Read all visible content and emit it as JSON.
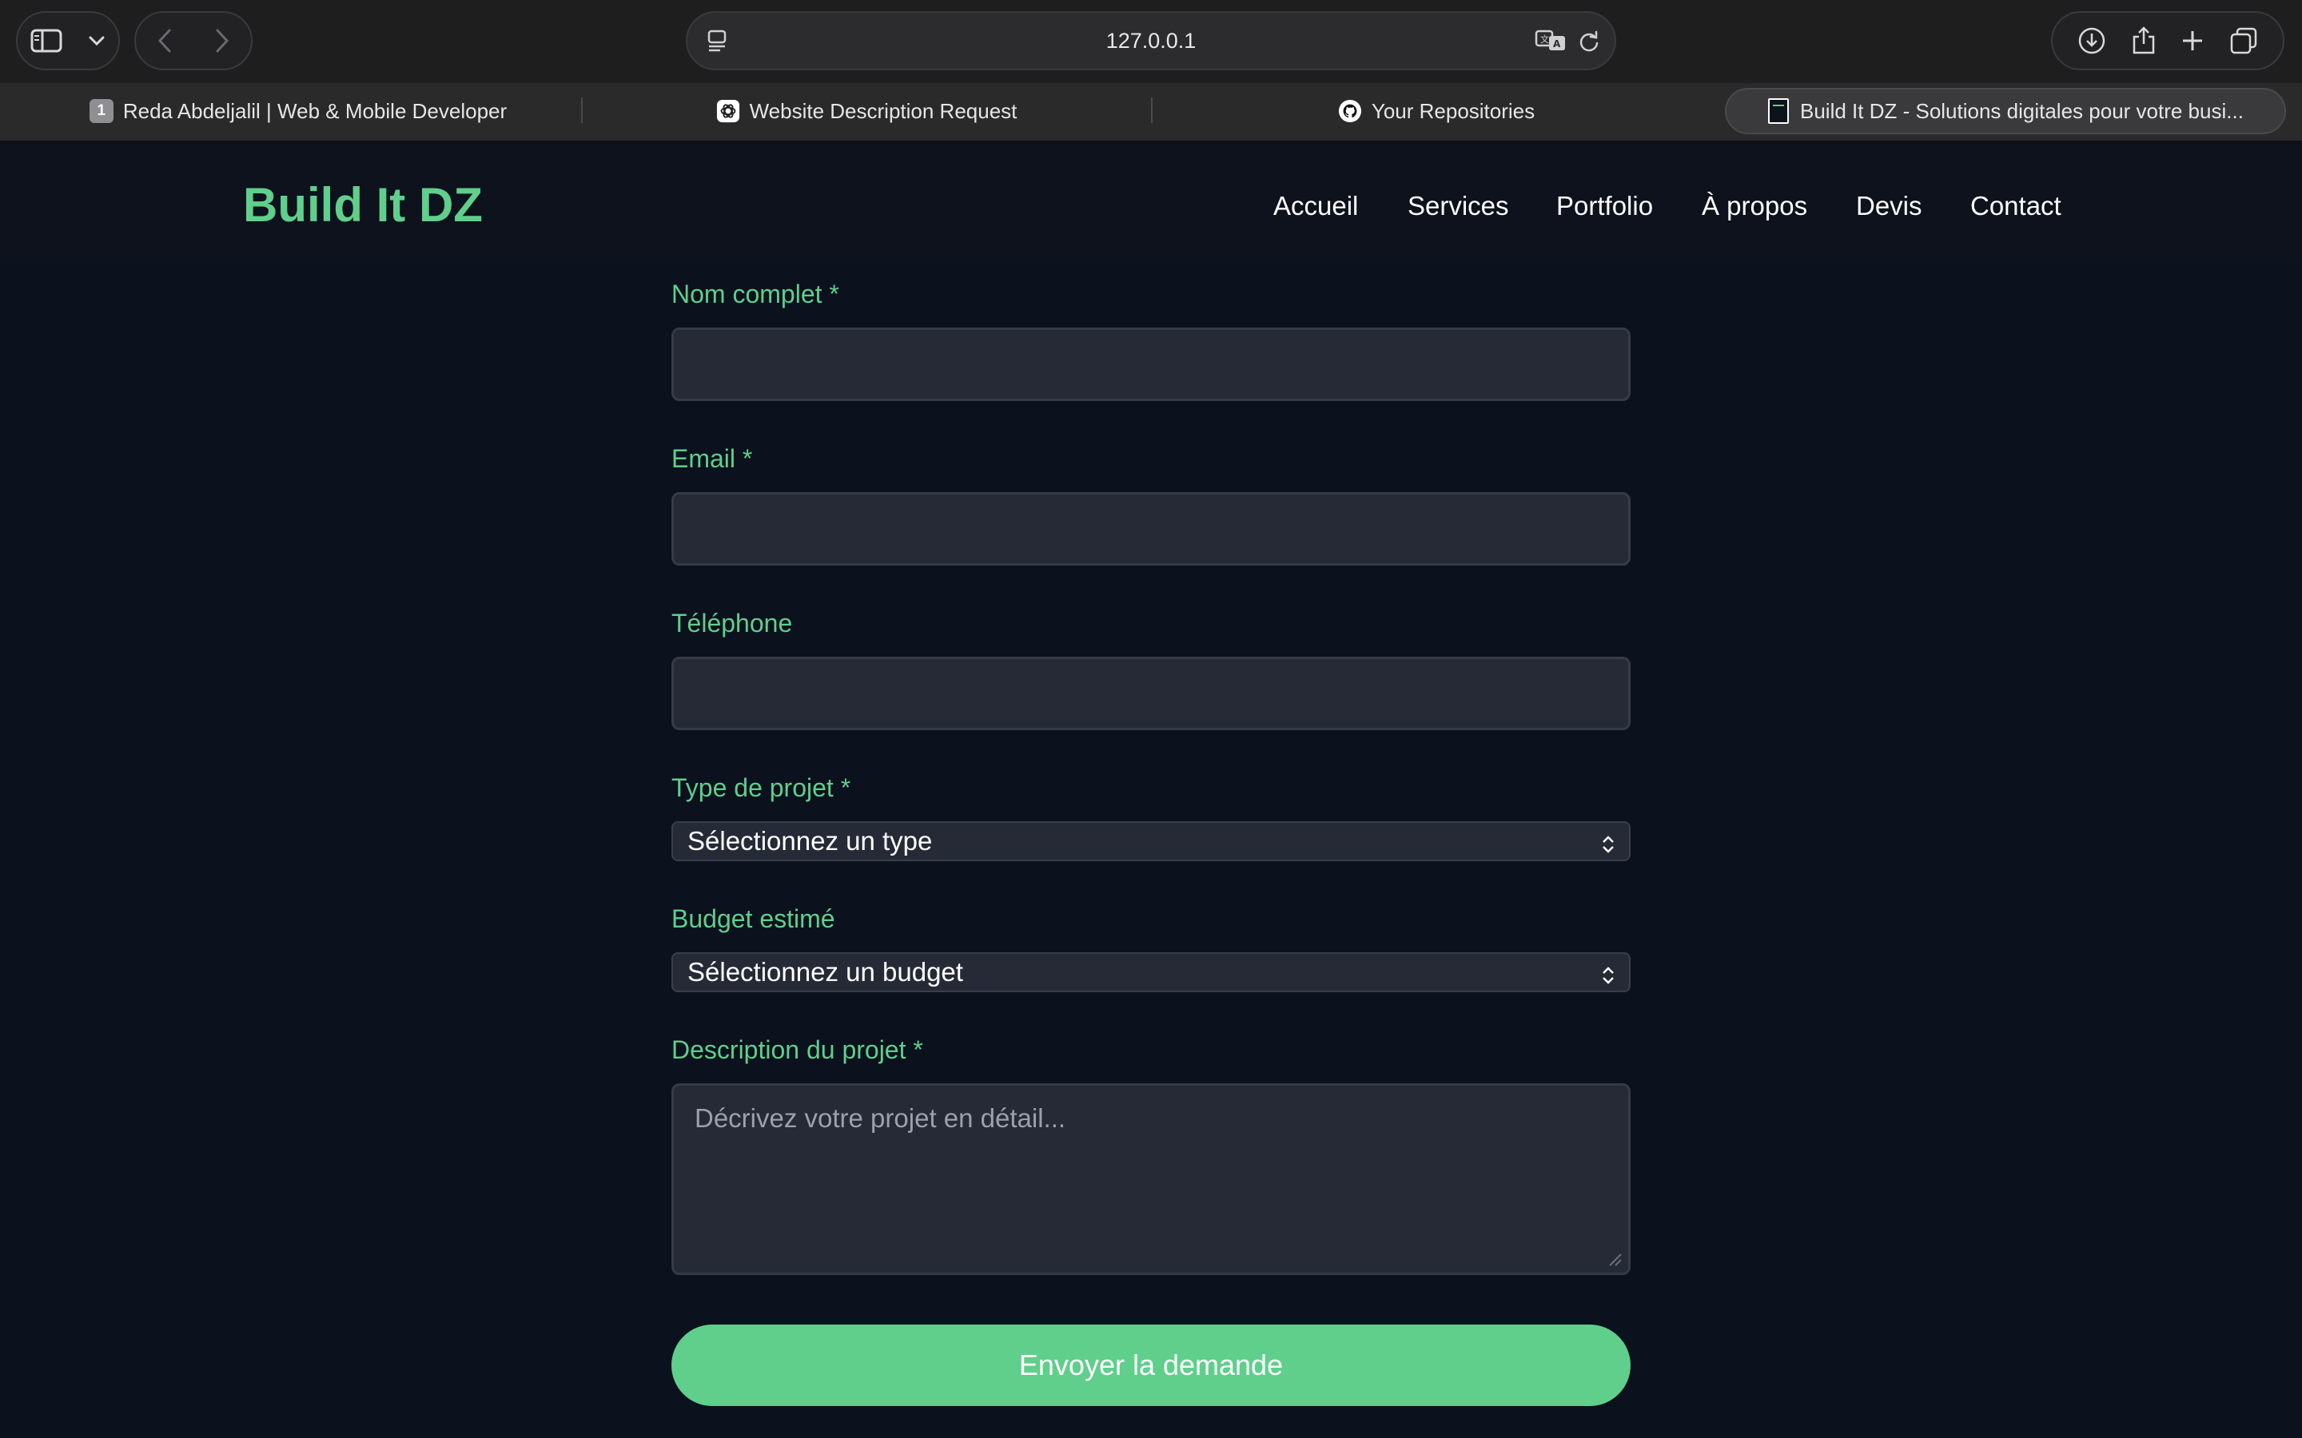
{
  "browser": {
    "url": "127.0.0.1",
    "tabs": [
      {
        "label": "Reda Abdeljalil | Web & Mobile Developer",
        "favicon_text": "1",
        "favicon": "numbered-badge-icon"
      },
      {
        "label": "Website Description Request",
        "favicon": "chatgpt-icon"
      },
      {
        "label": "Your Repositories",
        "favicon": "github-icon"
      },
      {
        "label": "Build It DZ - Solutions digitales pour votre busi...",
        "favicon": "page-thumbnail-icon",
        "active": true
      }
    ]
  },
  "site": {
    "brand": "Build It DZ",
    "nav": [
      "Accueil",
      "Services",
      "Portfolio",
      "À propos",
      "Devis",
      "Contact"
    ],
    "accent_color": "#5fcf8b",
    "background_color": "#0b111d"
  },
  "form": {
    "name_label": "Nom complet *",
    "email_label": "Email *",
    "phone_label": "Téléphone",
    "type_label": "Type de projet *",
    "type_selected": "Sélectionnez un type",
    "budget_label": "Budget estimé",
    "budget_selected": "Sélectionnez un budget",
    "description_label": "Description du projet *",
    "description_placeholder": "Décrivez votre projet en détail...",
    "submit_label": "Envoyer la demande"
  }
}
